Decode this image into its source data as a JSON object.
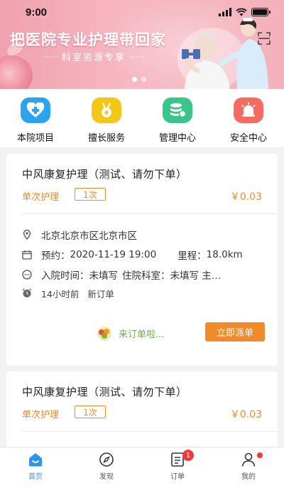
{
  "status_bar": {
    "time": "9:00"
  },
  "banner": {
    "title": "把医院专业护理带回家",
    "subtitle": "科室资源专享",
    "subtitle_left": "·····",
    "subtitle_right": "·····",
    "slide_index": 0,
    "slide_count": 2
  },
  "quick_nav": [
    {
      "label": "本院项目",
      "icon": "medical-kit-icon",
      "color": "#2aa3f0"
    },
    {
      "label": "擅长服务",
      "icon": "medal-icon",
      "color": "#f5c518"
    },
    {
      "label": "管理中心",
      "icon": "database-icon",
      "color": "#3cc58a"
    },
    {
      "label": "安全中心",
      "icon": "alarm-light-icon",
      "color": "#f56b62"
    }
  ],
  "orders": [
    {
      "title": "中风康复护理（测试、请勿下单）",
      "type": "单次护理",
      "count": "1次",
      "price": "￥0.03",
      "address": "北京北京市区北京市区",
      "appointment_label": "预约：",
      "appointment": "2020-11-19 19:00",
      "distance_label": "里程：",
      "distance": "18.0km",
      "admission_label": "入院时间：",
      "admission": "未填写",
      "department_label": "住院科室：",
      "department": "未填写 主…",
      "time_ago": "14小时前",
      "status": "新订单",
      "hint": "来订单啦...",
      "action": "立即派单"
    },
    {
      "title": "中风康复护理（测试、请勿下单）",
      "type": "单次护理",
      "count": "1次",
      "price": "￥0.03"
    }
  ],
  "tabbar": {
    "tabs": [
      {
        "label": "首页",
        "icon": "home-icon",
        "active": true
      },
      {
        "label": "发现",
        "icon": "compass-icon",
        "active": false
      },
      {
        "label": "订单",
        "icon": "orders-icon",
        "active": false,
        "badge": "1"
      },
      {
        "label": "我的",
        "icon": "profile-icon",
        "active": false
      }
    ]
  },
  "colors": {
    "accent": "#f08a2a",
    "active_tab": "#2a95f0",
    "banner": "#f3b1bc",
    "hint": "#6cb33e"
  }
}
